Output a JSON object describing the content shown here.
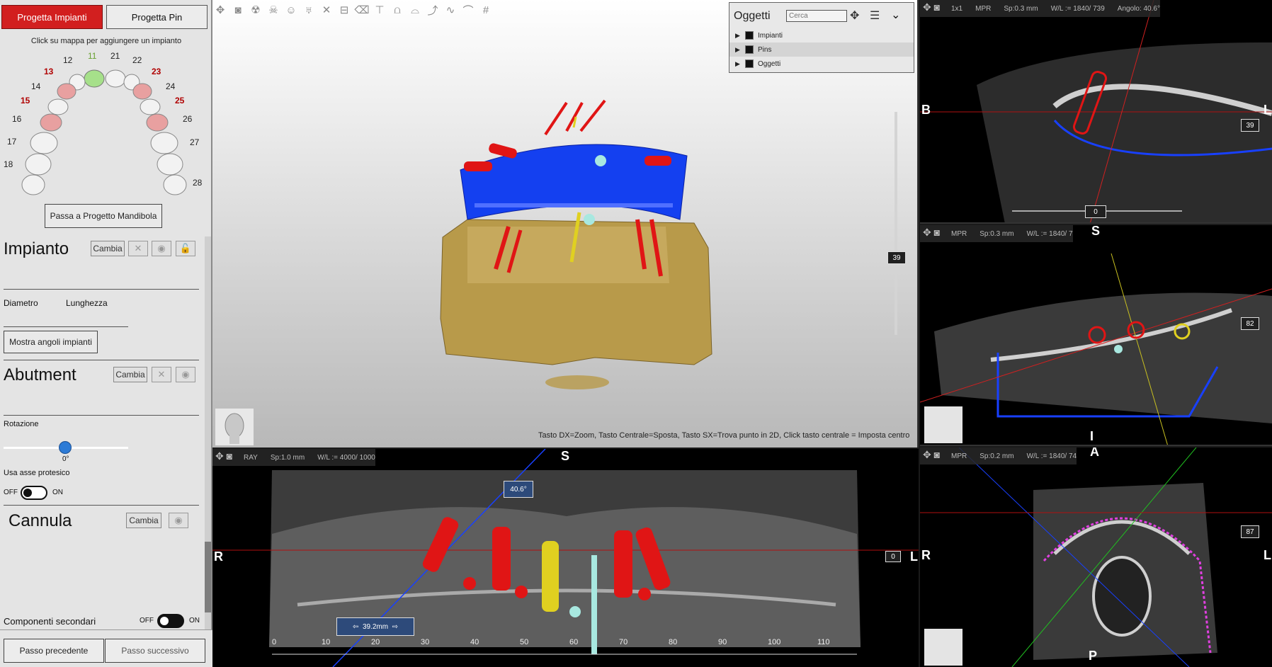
{
  "left": {
    "tabs": {
      "impianti": "Progetta Impianti",
      "pin": "Progetta Pin"
    },
    "hint": "Click su mappa per aggiungere un impianto",
    "teeth_upper_right": [
      "11",
      "12",
      "13",
      "14",
      "15",
      "16",
      "17",
      "18"
    ],
    "teeth_upper_left": [
      "21",
      "22",
      "23",
      "24",
      "25",
      "26",
      "27",
      "28"
    ],
    "mandibola_button": "Passa a Progetto Mandibola",
    "impianto": {
      "title": "Impianto",
      "cambia": "Cambia",
      "diametro": "Diametro",
      "lunghezza": "Lunghezza",
      "mostra_angoli": "Mostra angoli impianti"
    },
    "abutment": {
      "title": "Abutment",
      "cambia": "Cambia",
      "rotazione": "Rotazione",
      "rotazione_value": "0°",
      "usa_asse": "Usa asse protesico",
      "off": "OFF",
      "on": "ON"
    },
    "cannula": {
      "title": "Cannula",
      "cambia": "Cambia"
    },
    "componenti": {
      "label": "Componenti secondari",
      "off": "OFF",
      "on": "ON"
    },
    "nav": {
      "prev": "Passo precedente",
      "next": "Passo successivo"
    }
  },
  "oggetti": {
    "title": "Oggetti",
    "search_placeholder": "Cerca",
    "rows": [
      "Impianti",
      "Pins",
      "Oggetti"
    ]
  },
  "view3d": {
    "slider_value": "39",
    "help": "Tasto DX=Zoom, Tasto Centrale=Sposta, Tasto SX=Trova punto in 2D, Click tasto centrale = Imposta centro"
  },
  "mpr_top": {
    "hdr": [
      "1x1",
      "MPR",
      "Sp:0.3 mm",
      "W/L := 1840/ 739",
      "Angolo: 40.6°"
    ],
    "orient_left": "B",
    "orient_right": "L",
    "slice": "39",
    "bottom_value": "0"
  },
  "mpr_mid": {
    "hdr": [
      "MPR",
      "Sp:0.3 mm",
      "W/L := 1840/ 7"
    ],
    "orient_top": "S",
    "orient_bottom": "I",
    "orient_bottom2": "A",
    "slice": "82"
  },
  "mpr_bot": {
    "hdr": [
      "MPR",
      "Sp:0.2 mm",
      "W/L := 1840/ 74"
    ],
    "orient_left": "R",
    "orient_right": "L",
    "orient_bottom": "P",
    "slice": "87"
  },
  "pano": {
    "hdr": [
      "RAY",
      "Sp:1.0 mm",
      "W/L := 4000/ 1000"
    ],
    "orient_top": "S",
    "orient_left": "R",
    "orient_right": "L",
    "angle": "40.6°",
    "distance": "39.2mm",
    "slice": "0",
    "ruler": [
      "0",
      "10",
      "20",
      "30",
      "40",
      "50",
      "60",
      "70",
      "80",
      "90",
      "100",
      "110"
    ]
  },
  "colors": {
    "accent_red": "#d21f1f",
    "implant_red": "#e01515",
    "implant_yellow": "#e0d020",
    "guide_blue": "#1840ff",
    "bone": "#b89a4a"
  }
}
